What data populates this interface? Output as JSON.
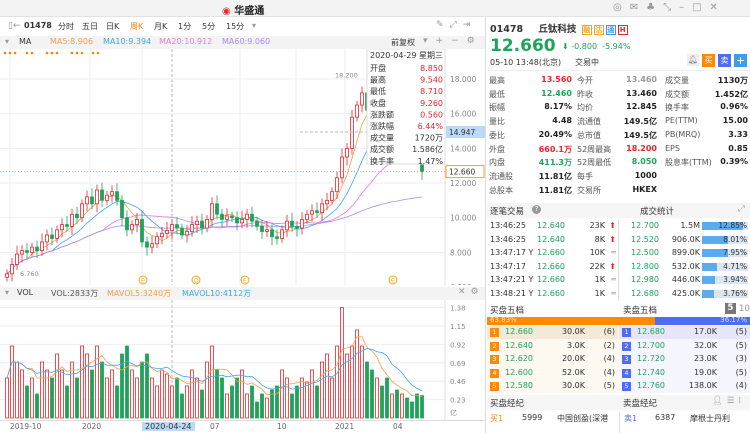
{
  "app": {
    "logo_text": "华盛通"
  },
  "toolbar": {
    "code": "01478",
    "periods": [
      "分时",
      "五日",
      "日K",
      "周K",
      "月K",
      "1分",
      "5分",
      "15分"
    ],
    "active_period": "周K"
  },
  "ma": {
    "label": "MA",
    "ma5": "MA5:8.906",
    "ma10": "MA10:9.394",
    "ma20": "MA20:10.912",
    "ma60": "MA60:9.060",
    "adjust": "前复权",
    "colors": {
      "ma5": "#f0a04b",
      "ma10": "#3aa8e8",
      "ma20": "#e67ad9",
      "ma60": "#a58cf0"
    }
  },
  "price_axis": {
    "ticks": [
      "18.000",
      "16.000",
      "14.000",
      "12.000",
      "10.000",
      "8.000",
      "6.000"
    ],
    "crosshair_value": "14.947",
    "last_price": "12.660",
    "max_label": "18.200",
    "min_label": "6.760"
  },
  "tooltip": {
    "date": "2020-04-29 星期三",
    "rows": [
      [
        "开盘",
        "8.850"
      ],
      [
        "最高",
        "9.540"
      ],
      [
        "最低",
        "8.710"
      ],
      [
        "收盘",
        "9.260"
      ],
      [
        "涨跌额",
        "0.560"
      ],
      [
        "涨跌幅",
        "6.44%"
      ],
      [
        "成交量",
        "1720万"
      ],
      [
        "成交额",
        "1.586亿"
      ],
      [
        "换手率",
        "1.47%"
      ]
    ]
  },
  "vol": {
    "label": "VOL",
    "vol": "VOL:2833万",
    "mavol5": "MAVOL5:3240万",
    "mavol10": "MAVOL10:4112万",
    "ticks": [
      "1.38",
      "1.15",
      "0.92",
      "0.69",
      "0.46",
      "0.23"
    ],
    "unit": "亿"
  },
  "date_axis": [
    "2019-10",
    "2020",
    "2020-04-24",
    "07",
    "10",
    "2021",
    "04"
  ],
  "events": [
    "E",
    "Q",
    "E",
    "E"
  ],
  "chart_data": {
    "type": "candlestick",
    "period": "weekly",
    "close": [
      6.76,
      7.3,
      7.9,
      8.1,
      8.0,
      8.3,
      8.1,
      8.6,
      9.0,
      8.8,
      9.3,
      9.6,
      9.5,
      10.2,
      10.0,
      10.8,
      11.2,
      10.8,
      11.6,
      11.0,
      11.3,
      11.5,
      11.0,
      10.0,
      9.3,
      9.6,
      9.9,
      8.6,
      8.3,
      8.5,
      8.9,
      9.1,
      9.26,
      9.6,
      9.4,
      9.0,
      9.2,
      9.6,
      9.8,
      9.4,
      9.9,
      10.8,
      10.2,
      9.9,
      10.1,
      10.0,
      9.7,
      9.9,
      10.2,
      9.8,
      9.5,
      9.2,
      9.3,
      8.9,
      8.8,
      9.3,
      9.8,
      9.5,
      9.4,
      9.9,
      10.2,
      10.4,
      10.3,
      10.8,
      11.0,
      11.5,
      12.3,
      13.5,
      14.0,
      15.8,
      16.5,
      17.2,
      16.2,
      15.5,
      16.0,
      15.4,
      14.9,
      15.2,
      14.4,
      14.8,
      14.3,
      13.8,
      13.46,
      12.66
    ],
    "volume": [
      0.5,
      0.9,
      0.7,
      0.6,
      0.4,
      0.5,
      0.3,
      0.7,
      0.6,
      0.5,
      0.8,
      0.6,
      0.4,
      0.7,
      0.5,
      0.9,
      0.8,
      0.6,
      0.9,
      0.7,
      0.5,
      0.6,
      0.4,
      0.8,
      0.9,
      0.6,
      0.5,
      0.7,
      0.8,
      0.5,
      0.4,
      0.6,
      0.55,
      0.4,
      0.5,
      0.3,
      0.4,
      0.6,
      0.5,
      0.35,
      0.7,
      0.9,
      0.6,
      0.5,
      0.3,
      0.4,
      0.5,
      0.6,
      0.3,
      0.4,
      0.2,
      0.3,
      0.25,
      0.35,
      0.4,
      0.6,
      0.5,
      0.3,
      0.4,
      0.5,
      0.45,
      0.6,
      0.4,
      0.7,
      0.8,
      0.5,
      0.9,
      1.38,
      0.8,
      0.9,
      1.1,
      0.9,
      0.7,
      0.6,
      0.5,
      0.4,
      0.5,
      0.3,
      0.35,
      0.3,
      0.25,
      0.2,
      0.3,
      0.28
    ],
    "ylim": [
      6,
      18.2
    ],
    "vol_ylim": [
      0,
      1.4
    ]
  },
  "quote": {
    "code": "01478",
    "name": "丘钛科技",
    "tags": [
      "融",
      "沽",
      "通",
      "H"
    ],
    "price": "12.660",
    "change": "-0.800",
    "change_pct": "-5.94%",
    "time": "05-10 13:48(北京)",
    "status": "交易中",
    "buttons": [
      "买",
      "卖",
      "+"
    ]
  },
  "stats": [
    [
      [
        "最高",
        "13.560",
        "red"
      ],
      [
        "今开",
        "13.460",
        "gray"
      ],
      [
        "成交量",
        "1130万",
        ""
      ]
    ],
    [
      [
        "最低",
        "12.460",
        "green"
      ],
      [
        "昨收",
        "13.460",
        ""
      ],
      [
        "成交额",
        "1.452亿",
        ""
      ]
    ],
    [
      [
        "振幅",
        "8.17%",
        ""
      ],
      [
        "均价",
        "12.845",
        ""
      ],
      [
        "换手率",
        "0.96%",
        ""
      ]
    ],
    [
      [
        "量比",
        "4.48",
        ""
      ],
      [
        "流通值",
        "149.5亿",
        ""
      ],
      [
        "PE(TTM)",
        "15.00",
        ""
      ]
    ],
    [
      [
        "委比",
        "20.49%",
        ""
      ],
      [
        "总市值",
        "149.5亿",
        ""
      ],
      [
        "PB(MRQ)",
        "3.33",
        ""
      ]
    ],
    [
      [
        "外盘",
        "660.1万",
        "red"
      ],
      [
        "52周最高",
        "18.200",
        "red"
      ],
      [
        "EPS",
        "0.85",
        ""
      ]
    ],
    [
      [
        "内盘",
        "411.3万",
        "green"
      ],
      [
        "52周最低",
        "8.050",
        "green"
      ],
      [
        "股息率(TTM)",
        "0.39%",
        ""
      ]
    ],
    [
      [
        "流通股",
        "11.81亿",
        ""
      ],
      [
        "每手",
        "1000",
        ""
      ],
      [
        "",
        "",
        " "
      ]
    ],
    [
      [
        "总股本",
        "11.81亿",
        ""
      ],
      [
        "交易所",
        "HKEX",
        ""
      ],
      [
        "",
        "",
        " "
      ]
    ]
  ],
  "trades": {
    "title": "逐笔交易",
    "rows": [
      [
        "13:46:25",
        "12.640",
        "23K",
        "up"
      ],
      [
        "13:46:25",
        "12.640",
        "8K",
        "up"
      ],
      [
        "13:47:17 Y",
        "12.660",
        "10K",
        "flat"
      ],
      [
        "13:47:17",
        "12.660",
        "22K",
        "up"
      ],
      [
        "13:47:21 Y",
        "12.660",
        "1K",
        "flat"
      ],
      [
        "13:48:21 Y",
        "12.660",
        "1K",
        "flat"
      ]
    ]
  },
  "stat": {
    "title": "成交统计",
    "rows": [
      [
        "12.700",
        "1.5M",
        "12.85%",
        12.85
      ],
      [
        "12.520",
        "906.0K",
        "8.01%",
        8.01
      ],
      [
        "12.500",
        "899.0K",
        "7.95%",
        7.95
      ],
      [
        "12.800",
        "532.0K",
        "4.71%",
        4.71
      ],
      [
        "12.980",
        "446.0K",
        "3.94%",
        3.94
      ],
      [
        "12.680",
        "425.0K",
        "3.76%",
        3.76
      ]
    ]
  },
  "depth": {
    "bid_title": "买盘五档",
    "ask_title": "卖盘五档",
    "level_options": [
      "5",
      "10"
    ],
    "bid_pct": "63.83%",
    "ask_pct": "36.17%",
    "bid_ratio": 63.83,
    "bids": [
      [
        "1",
        "12.660",
        "30.0K",
        "(6)"
      ],
      [
        "2",
        "12.640",
        "3.0K",
        "(2)"
      ],
      [
        "3",
        "12.620",
        "20.0K",
        "(4)"
      ],
      [
        "4",
        "12.600",
        "52.0K",
        "(4)"
      ],
      [
        "5",
        "12.580",
        "30.0K",
        "(5)"
      ]
    ],
    "asks": [
      [
        "1",
        "12.680",
        "17.0K",
        "(5)"
      ],
      [
        "2",
        "12.700",
        "32.0K",
        "(5)"
      ],
      [
        "3",
        "12.720",
        "23.0K",
        "(3)"
      ],
      [
        "4",
        "12.740",
        "19.0K",
        "(5)"
      ],
      [
        "5",
        "12.760",
        "138.0K",
        "(4)"
      ]
    ]
  },
  "brokers": {
    "bid_title": "买盘经纪",
    "ask_title": "卖盘经纪",
    "bid": [
      "买1",
      "5999",
      "中国创盈(深港"
    ],
    "ask": [
      "卖1",
      "6387",
      "摩根士丹利"
    ]
  },
  "colors": {
    "up": "#e8262d",
    "down": "#1fa35b",
    "bid": "#ff8a00",
    "ask": "#4f6cf5"
  }
}
